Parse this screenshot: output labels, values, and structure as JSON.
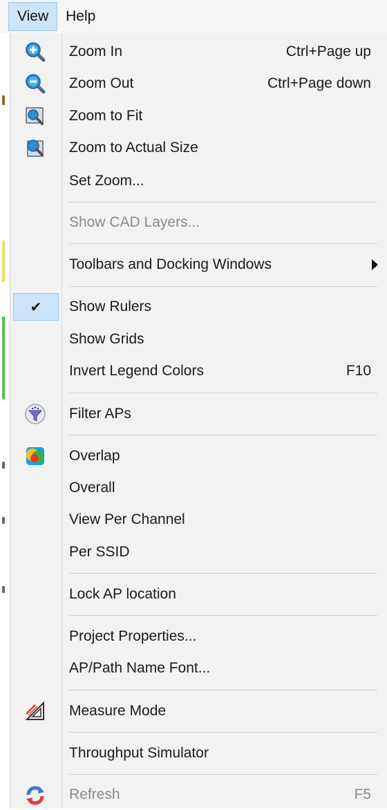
{
  "menubar": {
    "items": [
      "View",
      "Help"
    ]
  },
  "menu": {
    "zoom_in": {
      "label": "Zoom In",
      "shortcut": "Ctrl+Page up",
      "icon": "zoom-in-icon"
    },
    "zoom_out": {
      "label": "Zoom Out",
      "shortcut": "Ctrl+Page down",
      "icon": "zoom-out-icon"
    },
    "zoom_fit": {
      "label": "Zoom to Fit",
      "icon": "zoom-fit-icon"
    },
    "zoom_actual": {
      "label": "Zoom to Actual Size",
      "icon": "zoom-actual-icon"
    },
    "set_zoom": {
      "label": "Set Zoom..."
    },
    "show_cad": {
      "label": "Show CAD Layers...",
      "disabled": true
    },
    "toolbars": {
      "label": "Toolbars and Docking Windows",
      "submenu": true
    },
    "show_rulers": {
      "label": "Show Rulers",
      "checked": true,
      "check_glyph": "✔"
    },
    "show_grids": {
      "label": "Show Grids"
    },
    "invert_legend": {
      "label": "Invert Legend Colors",
      "shortcut": "F10"
    },
    "filter_aps": {
      "label": "Filter APs",
      "icon": "filter-aps-icon"
    },
    "overlap": {
      "label": "Overlap",
      "icon": "overlap-icon"
    },
    "overall": {
      "label": "Overall"
    },
    "view_per_channel": {
      "label": "View Per Channel"
    },
    "per_ssid": {
      "label": "Per SSID"
    },
    "lock_ap": {
      "label": "Lock AP location"
    },
    "project_props": {
      "label": "Project Properties..."
    },
    "ap_path_font": {
      "label": "AP/Path Name Font..."
    },
    "measure_mode": {
      "label": "Measure Mode",
      "icon": "measure-icon"
    },
    "throughput_sim": {
      "label": "Throughput Simulator"
    },
    "refresh": {
      "label": "Refresh",
      "shortcut": "F5",
      "disabled": true,
      "icon": "refresh-icon"
    }
  },
  "colors": {
    "highlight": "#cce4f7",
    "highlight_border": "#99c9ef",
    "menu_bg": "#f2f2f2",
    "disabled_text": "#8a8a8a"
  }
}
